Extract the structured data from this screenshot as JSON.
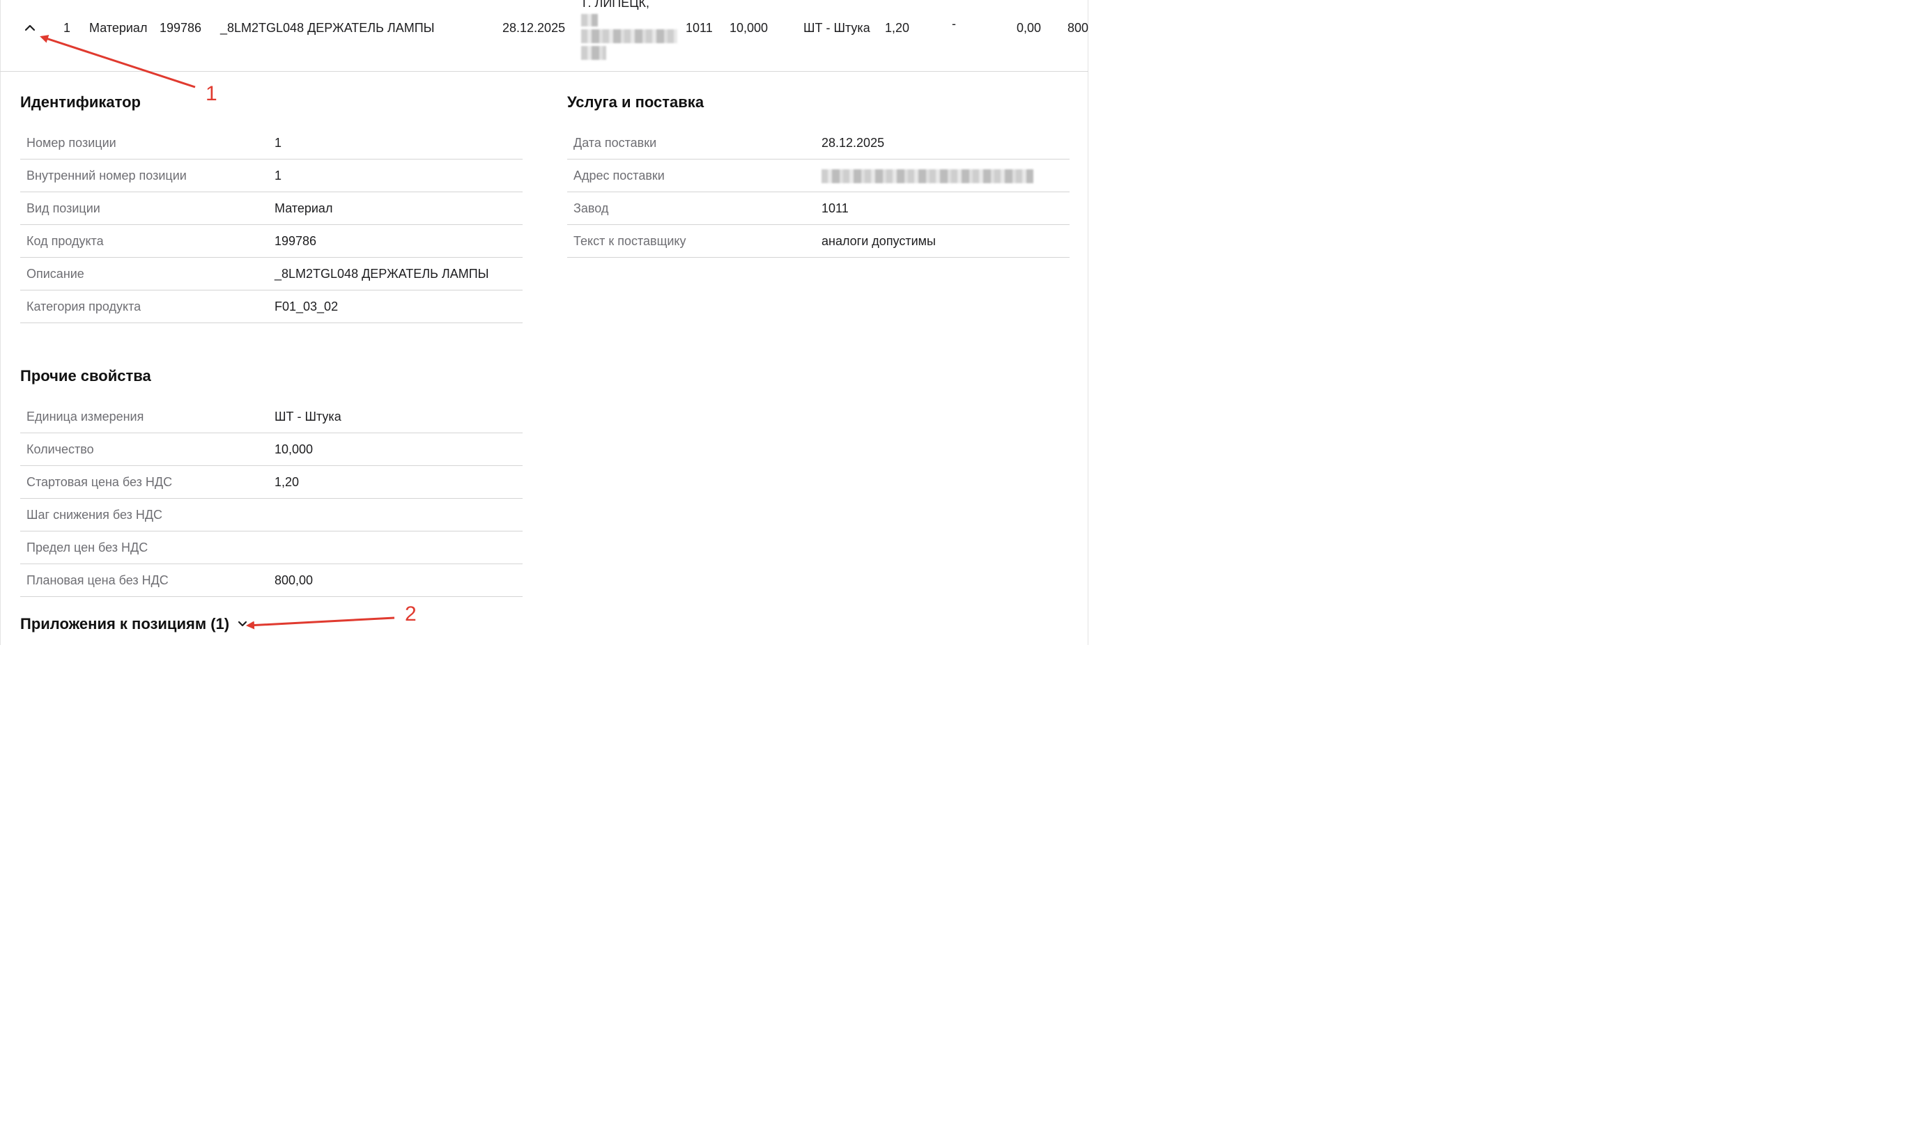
{
  "header_row": {
    "index": "1",
    "type": "Материал",
    "code": "199786",
    "description": "_8LM2TGL048 ДЕРЖАТЕЛЬ ЛАМПЫ",
    "date": "28.12.2025",
    "address_top": "Г. ЛИПЕЦК,",
    "plant": "1011",
    "quantity": "10,000",
    "unit": "ШТ - Штука",
    "price": "1,20",
    "step": "-",
    "limit": "0,00",
    "planned": "800"
  },
  "identifier": {
    "title": "Идентификатор",
    "rows": [
      {
        "label": "Номер позиции",
        "value": "1"
      },
      {
        "label": "Внутренний номер позиции",
        "value": "1"
      },
      {
        "label": "Вид позиции",
        "value": "Материал"
      },
      {
        "label": "Код продукта",
        "value": "199786"
      },
      {
        "label": "Описание",
        "value": "_8LM2TGL048 ДЕРЖАТЕЛЬ ЛАМПЫ"
      },
      {
        "label": "Категория продукта",
        "value": "F01_03_02"
      }
    ]
  },
  "service": {
    "title": "Услуга и поставка",
    "rows": [
      {
        "label": "Дата поставки",
        "value": "28.12.2025"
      },
      {
        "label": "Адрес поставки",
        "value": ""
      },
      {
        "label": "Завод",
        "value": "1011"
      },
      {
        "label": "Текст к поставщику",
        "value": "аналоги допустимы"
      }
    ]
  },
  "other": {
    "title": "Прочие свойства",
    "rows": [
      {
        "label": "Единица измерения",
        "value": "ШТ - Штука"
      },
      {
        "label": "Количество",
        "value": "10,000"
      },
      {
        "label": "Стартовая цена без НДС",
        "value": "1,20"
      },
      {
        "label": "Шаг снижения без НДС",
        "value": ""
      },
      {
        "label": "Предел цен без НДС",
        "value": ""
      },
      {
        "label": "Плановая цена без НДС",
        "value": "800,00"
      }
    ]
  },
  "attachments": {
    "title": "Приложения к позициям (1)"
  },
  "annotations": {
    "one": "1",
    "two": "2"
  },
  "colors": {
    "annotation": "#e03a2f",
    "label": "#6e6e73",
    "divider": "#d4d4d4"
  }
}
